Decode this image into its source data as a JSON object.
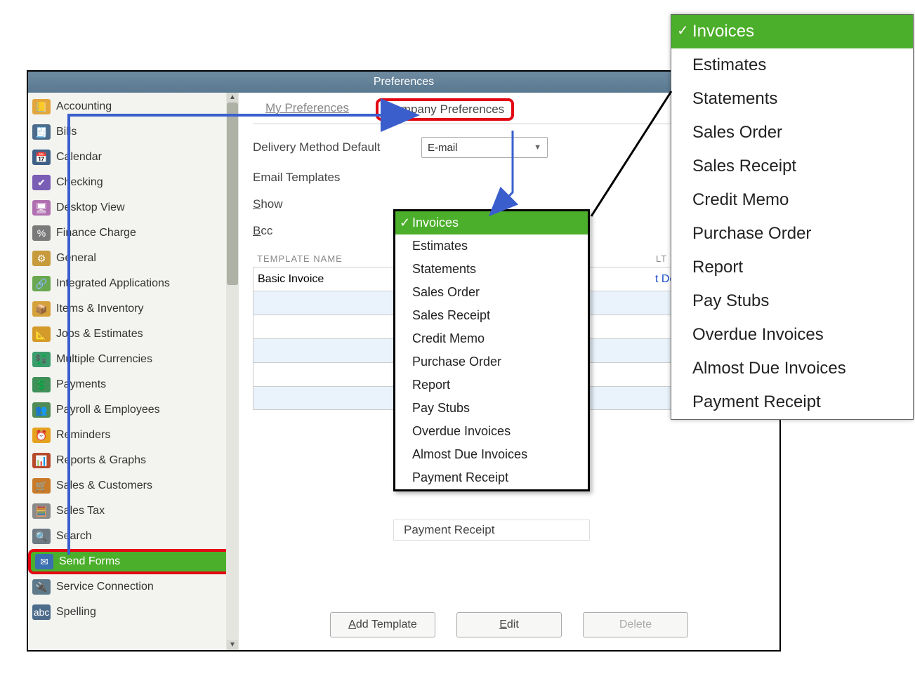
{
  "window": {
    "title": "Preferences"
  },
  "sidebar": {
    "items": [
      {
        "label": "Accounting",
        "icon": "📒",
        "bg": "#e2a63d"
      },
      {
        "label": "Bills",
        "icon": "🧾",
        "bg": "#4d6b8a"
      },
      {
        "label": "Calendar",
        "icon": "📅",
        "bg": "#3e5f86"
      },
      {
        "label": "Checking",
        "icon": "✔",
        "bg": "#7a5db5"
      },
      {
        "label": "Desktop View",
        "icon": "🖥",
        "bg": "#b06fb0"
      },
      {
        "label": "Finance Charge",
        "icon": "%",
        "bg": "#7a7a7a"
      },
      {
        "label": "General",
        "icon": "⚙",
        "bg": "#c79a3b"
      },
      {
        "label": "Integrated Applications",
        "icon": "🔗",
        "bg": "#6aa84f"
      },
      {
        "label": "Items & Inventory",
        "icon": "📦",
        "bg": "#d4a13a"
      },
      {
        "label": "Jobs & Estimates",
        "icon": "📐",
        "bg": "#d49a2a"
      },
      {
        "label": "Multiple Currencies",
        "icon": "💱",
        "bg": "#3a9b6b"
      },
      {
        "label": "Payments",
        "icon": "💲",
        "bg": "#3f8f58"
      },
      {
        "label": "Payroll & Employees",
        "icon": "👥",
        "bg": "#4f8a57"
      },
      {
        "label": "Reminders",
        "icon": "⏰",
        "bg": "#e6a21d"
      },
      {
        "label": "Reports & Graphs",
        "icon": "📊",
        "bg": "#b74a2a"
      },
      {
        "label": "Sales & Customers",
        "icon": "🛒",
        "bg": "#c97a28"
      },
      {
        "label": "Sales Tax",
        "icon": "🧮",
        "bg": "#8a8a8a"
      },
      {
        "label": "Search",
        "icon": "🔍",
        "bg": "#6d7a84"
      },
      {
        "label": "Send Forms",
        "icon": "✉",
        "bg": "#3a6fb0",
        "selected": true
      },
      {
        "label": "Service Connection",
        "icon": "🔌",
        "bg": "#5e7a8a"
      },
      {
        "label": "Spelling",
        "icon": "abc",
        "bg": "#4d6b8a"
      }
    ]
  },
  "tabs": {
    "my": "My Preferences",
    "company": "Company Preferences"
  },
  "fields": {
    "delivery_label": "Delivery Method Default",
    "delivery_value": "E-mail",
    "email_templates_label": "Email Templates",
    "show_label": "Show",
    "bcc_label": "Bcc"
  },
  "table": {
    "header_name": "TEMPLATE NAME",
    "header_default": "LT TEMPLAT",
    "rows": [
      {
        "name": "Basic Invoice",
        "def": "t Default"
      },
      {
        "name": "",
        "def": ""
      },
      {
        "name": "",
        "def": ""
      },
      {
        "name": "",
        "def": ""
      },
      {
        "name": "",
        "def": ""
      },
      {
        "name": "",
        "def": ""
      }
    ]
  },
  "buttons": {
    "add": "Add Template",
    "edit": "Edit",
    "delete": "Delete"
  },
  "dropdown_options": [
    "Invoices",
    "Estimates",
    "Statements",
    "Sales Order",
    "Sales Receipt",
    "Credit Memo",
    "Purchase Order",
    "Report",
    "Pay Stubs",
    "Overdue Invoices",
    "Almost Due Invoices",
    "Payment Receipt"
  ],
  "dd_peek": "Payment Receipt"
}
